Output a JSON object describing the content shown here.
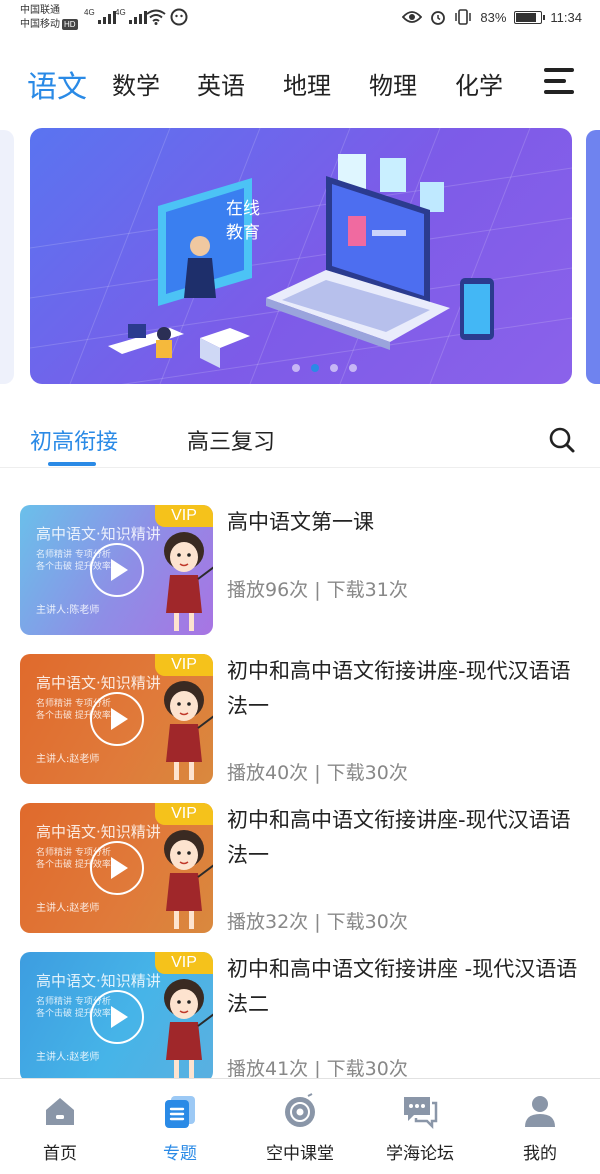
{
  "status_bar": {
    "carrier1": "中国联通",
    "carrier2": "中国移动",
    "hd_badge": "HD",
    "network1": "4G",
    "network2": "4G",
    "battery_percent": "83%",
    "battery_level": 0.83,
    "time": "11:34",
    "icons": [
      "eye-icon",
      "alarm-icon",
      "vibrate-icon",
      "battery-icon",
      "wifi-icon",
      "message-icon"
    ]
  },
  "subjects": {
    "items": [
      "语文",
      "数学",
      "英语",
      "地理",
      "物理",
      "化学"
    ],
    "active_index": 0,
    "menu_icon": "menu-icon"
  },
  "banner": {
    "slide_count": 4,
    "active_slide": 1,
    "text_line1": "在线",
    "text_line2": "教育"
  },
  "category_tabs": {
    "items": [
      "初高衔接",
      "高三复习"
    ],
    "active_index": 0,
    "search_icon": "search-icon"
  },
  "courses": [
    {
      "title": "高中语文第一课",
      "stats": "播放96次 | 下载31次",
      "thumb_title": "高中语文·知识精讲",
      "thumb_sub1": "名师精讲  专项分析",
      "thumb_sub2": "各个击破  提升效率",
      "thumb_teacher": "主讲人:陈老师",
      "vip": "VIP",
      "theme": "purple"
    },
    {
      "title": "初中和高中语文衔接讲座-现代汉语语法一",
      "stats": "播放40次 | 下载30次",
      "thumb_title": "高中语文·知识精讲",
      "thumb_sub1": "名师精讲  专项分析",
      "thumb_sub2": "各个击破  提升效率",
      "thumb_teacher": "主讲人:赵老师",
      "vip": "VIP",
      "theme": "orange"
    },
    {
      "title": "初中和高中语文衔接讲座-现代汉语语法一",
      "stats": "播放32次 | 下载30次",
      "thumb_title": "高中语文·知识精讲",
      "thumb_sub1": "名师精讲  专项分析",
      "thumb_sub2": "各个击破  提升效率",
      "thumb_teacher": "主讲人:赵老师",
      "vip": "VIP",
      "theme": "orange"
    },
    {
      "title": "初中和高中语文衔接讲座 -现代汉语语法二",
      "stats": "播放41次 | 下载30次",
      "thumb_title": "高中语文·知识精讲",
      "thumb_sub1": "名师精讲  专项分析",
      "thumb_sub2": "各个击破  提升效率",
      "thumb_teacher": "主讲人:赵老师",
      "vip": "VIP",
      "theme": "teal"
    }
  ],
  "bottom_nav": {
    "items": [
      {
        "label": "首页",
        "icon": "home-icon"
      },
      {
        "label": "专题",
        "icon": "topic-icon"
      },
      {
        "label": "空中课堂",
        "icon": "disc-icon"
      },
      {
        "label": "学海论坛",
        "icon": "forum-icon"
      },
      {
        "label": "我的",
        "icon": "user-icon"
      }
    ],
    "active_index": 1
  },
  "colors": {
    "accent": "#2a8ae6",
    "vip": "#f5c21b",
    "nav_inactive": "#8a96a8"
  }
}
